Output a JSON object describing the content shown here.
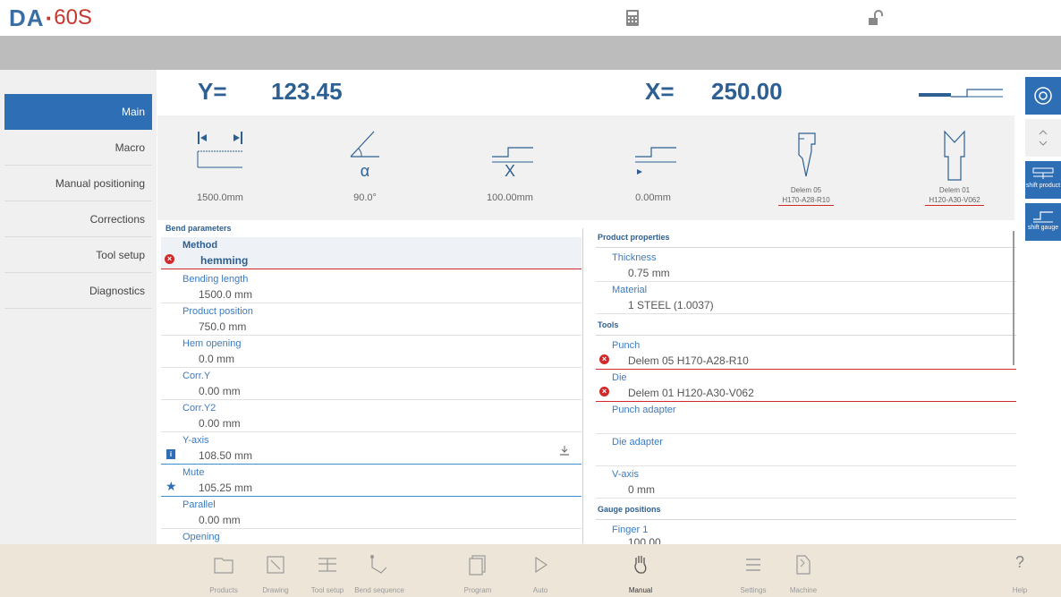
{
  "header": {
    "brand_bold": "DA",
    "brand_model": "60S",
    "icons": [
      "calculator-icon",
      "unlock-icon"
    ]
  },
  "sidebar": {
    "items": [
      {
        "label": "Main",
        "active": true
      },
      {
        "label": "Macro"
      },
      {
        "label": "Manual positioning"
      },
      {
        "label": "Corrections"
      },
      {
        "label": "Tool setup"
      },
      {
        "label": "Diagnostics"
      }
    ]
  },
  "positions": {
    "y_label": "Y=",
    "y_value": "123.45",
    "x_label": "X=",
    "x_value": "250.00"
  },
  "summary": {
    "length": "1500.0mm",
    "angle_symbol": "α",
    "angle": "90.0°",
    "x_symbol": "X",
    "x_value": "100.00mm",
    "gauge_value": "0.00mm",
    "punch_name": "Delem 05",
    "punch_code": "H170-A28-R10",
    "die_name": "Delem 01",
    "die_code": "H120-A30-V062"
  },
  "right_buttons": [
    {
      "icon": "machine-state-icon"
    },
    {
      "icon": "up-down-icon"
    },
    {
      "icon": "shift-product-icon",
      "label": "shift product"
    },
    {
      "icon": "shift-gauge-icon",
      "label": "shift gauge"
    }
  ],
  "bend_params": {
    "title": "Bend parameters",
    "method": {
      "label": "Method",
      "value": "hemming"
    },
    "items": [
      {
        "label": "Bending length",
        "value": "1500.0 mm"
      },
      {
        "label": "Product position",
        "value": "750.0 mm"
      },
      {
        "label": "Hem opening",
        "value": "0.0 mm"
      },
      {
        "label": "Corr.Y",
        "value": "0.00 mm"
      },
      {
        "label": "Corr.Y2",
        "value": "0.00 mm"
      },
      {
        "label": "Y-axis",
        "value": "108.50 mm"
      },
      {
        "label": "Mute",
        "value": "105.25 mm"
      },
      {
        "label": "Parallel",
        "value": "0.00 mm"
      },
      {
        "label": "Opening",
        "value": ""
      }
    ]
  },
  "product_props": {
    "title": "Product properties",
    "thickness": {
      "label": "Thickness",
      "value": "0.75 mm"
    },
    "material": {
      "label": "Material",
      "value": "1 STEEL (1.0037)"
    }
  },
  "tools": {
    "title": "Tools",
    "punch": {
      "label": "Punch",
      "value": "Delem 05 H170-A28-R10"
    },
    "die": {
      "label": "Die",
      "value": "Delem 01 H120-A30-V062"
    },
    "punch_adapter": {
      "label": "Punch adapter",
      "value": ""
    },
    "die_adapter": {
      "label": "Die adapter",
      "value": ""
    },
    "v_axis": {
      "label": "V-axis",
      "value": "0 mm"
    }
  },
  "gauge_positions": {
    "title": "Gauge positions",
    "finger1": {
      "label": "Finger 1",
      "value": "100.00"
    }
  },
  "toolbar": {
    "items": [
      {
        "label": "Products",
        "icon": "folder-icon"
      },
      {
        "label": "Drawing",
        "icon": "drawing-icon"
      },
      {
        "label": "Tool setup",
        "icon": "tool-setup-icon"
      },
      {
        "label": "Bend sequence",
        "icon": "bend-sequence-icon"
      },
      {
        "label": "Program",
        "icon": "program-icon"
      },
      {
        "label": "Auto",
        "icon": "play-icon"
      },
      {
        "label": "Manual",
        "icon": "hand-icon",
        "active": true
      },
      {
        "label": "Settings",
        "icon": "list-icon"
      },
      {
        "label": "Machine",
        "icon": "machine-icon"
      },
      {
        "label": "Help",
        "icon": "help-icon"
      }
    ]
  }
}
